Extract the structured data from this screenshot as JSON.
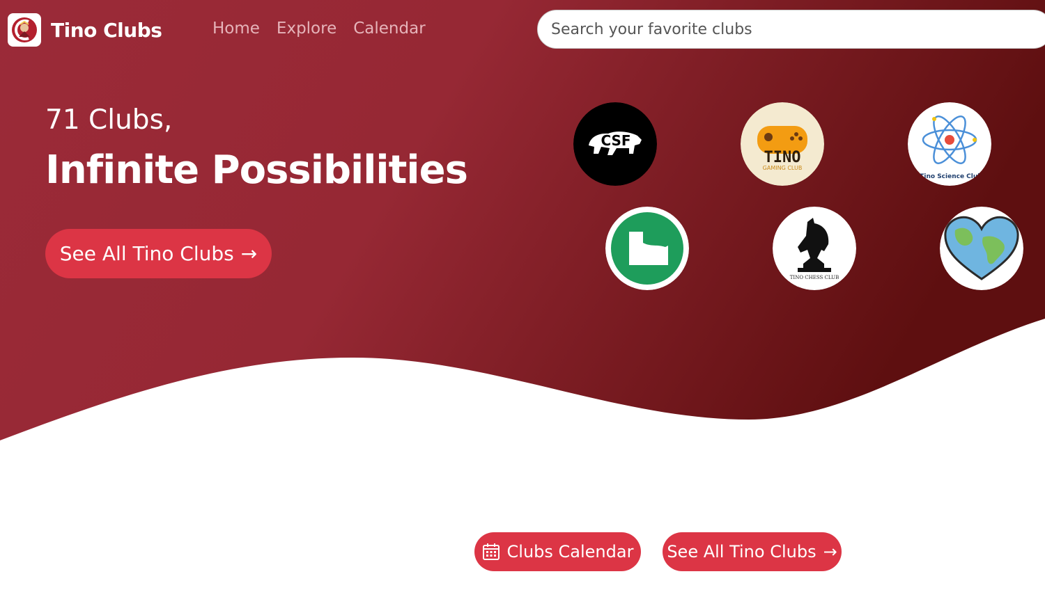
{
  "brand": {
    "title": "Tino Clubs"
  },
  "nav": {
    "items": [
      "Home",
      "Explore",
      "Calendar"
    ]
  },
  "search": {
    "placeholder": "Search your favorite clubs"
  },
  "hero": {
    "subtitle": "71 Clubs,",
    "title": "Infinite Possibilities",
    "cta_label": "See All Tino Clubs",
    "cta_arrow": "→"
  },
  "clubs": [
    {
      "name": "CSF",
      "logo_text": "CSF"
    },
    {
      "name": "Tino Gaming Club",
      "logo_text": "TINO",
      "logo_subtext": "GAMING CLUB"
    },
    {
      "name": "Tino Science Club",
      "logo_text": "Tino Science Club"
    },
    {
      "name": "Google Sheets style club",
      "logo_text": ""
    },
    {
      "name": "Tino Chess Club",
      "logo_text": "TINO CHESS CLUB"
    },
    {
      "name": "Earth heart club",
      "logo_text": ""
    }
  ],
  "bottom": {
    "calendar_label": "Clubs Calendar",
    "all_clubs_label": "See All Tino Clubs",
    "arrow": "→"
  },
  "colors": {
    "hero_start": "#a02a3a",
    "hero_end": "#5f0f10",
    "button": "#dc3545",
    "nav_link": "#e6b4ba"
  }
}
